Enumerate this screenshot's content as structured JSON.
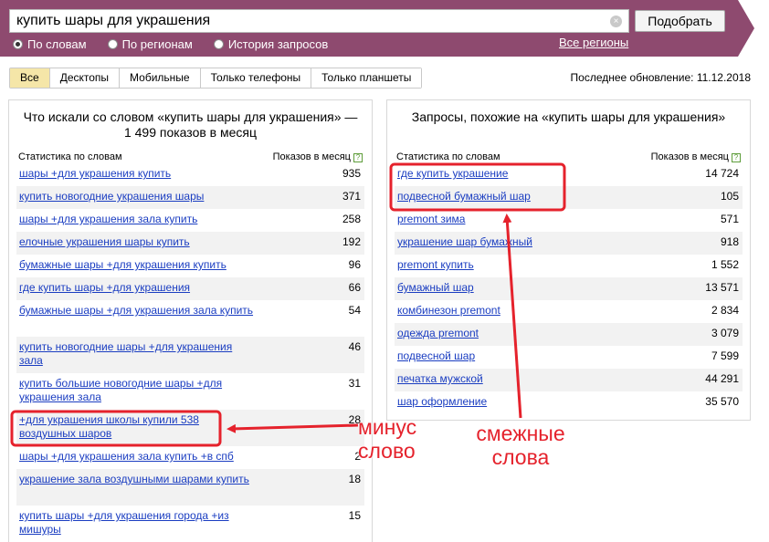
{
  "search": {
    "query": "купить шары для украшения",
    "submit_label": "Подобрать",
    "clear_symbol": "×",
    "modes": [
      {
        "label": "По словам",
        "checked": true
      },
      {
        "label": "По регионам",
        "checked": false
      },
      {
        "label": "История запросов",
        "checked": false
      }
    ],
    "regions_link": "Все регионы"
  },
  "devices": {
    "tabs": [
      "Все",
      "Десктопы",
      "Мобильные",
      "Только телефоны",
      "Только планшеты"
    ],
    "active_index": 0
  },
  "last_update": "Последнее обновление: 11.12.2018",
  "left_panel": {
    "title": "Что искали со словом «купить шары для украшения» — 1 499 показов в месяц",
    "col_query": "Статистика по словам",
    "col_count": "Показов в месяц",
    "help_symbol": "?",
    "rows": [
      {
        "q": "шары +для украшения купить",
        "n": "935"
      },
      {
        "q": "купить новогодние украшения шары",
        "n": "371"
      },
      {
        "q": "шары +для украшения зала купить",
        "n": "258"
      },
      {
        "q": "елочные украшения шары купить",
        "n": "192"
      },
      {
        "q": "бумажные шары +для украшения купить",
        "n": "96"
      },
      {
        "q": "где купить шары +для украшения",
        "n": "66"
      },
      {
        "q": "бумажные шары +для украшения зала купить",
        "n": "54"
      },
      {
        "q": "купить новогодние шары +для украшения зала",
        "n": "46"
      },
      {
        "q": "купить большие новогодние шары +для украшения зала",
        "n": "31"
      },
      {
        "q": "+для украшения школы купили 538 воздушных шаров",
        "n": "28"
      },
      {
        "q": "шары +для украшения зала купить +в спб",
        "n": "2"
      },
      {
        "q": "украшение зала воздушными шарами купить",
        "n": "18"
      },
      {
        "q": "купить шары +для украшения города +из мишуры",
        "n": "15"
      }
    ]
  },
  "right_panel": {
    "title": "Запросы, похожие на «купить шары для украшения»",
    "col_query": "Статистика по словам",
    "col_count": "Показов в месяц",
    "help_symbol": "?",
    "rows": [
      {
        "q": "где купить украшение",
        "n": "14 724"
      },
      {
        "q": "подвесной бумажный шар",
        "n": "105"
      },
      {
        "q": "premont зима",
        "n": "571"
      },
      {
        "q": "украшение шар бумажный",
        "n": "918"
      },
      {
        "q": "premont купить",
        "n": "1 552"
      },
      {
        "q": "бумажный шар",
        "n": "13 571"
      },
      {
        "q": "комбинезон premont",
        "n": "2 834"
      },
      {
        "q": "одежда premont",
        "n": "3 079"
      },
      {
        "q": "подвесной шар",
        "n": "7 599"
      },
      {
        "q": "печатка мужской",
        "n": "44 291"
      },
      {
        "q": "шар оформление",
        "n": "35 570"
      }
    ]
  },
  "annotations": {
    "minus_word": "минус слово",
    "related_words": "смежные слова",
    "color": "#e5222c"
  },
  "colors": {
    "header_band": "#8e4a6f",
    "link": "#1a3dc1",
    "active_tab": "#f5e6a8"
  }
}
